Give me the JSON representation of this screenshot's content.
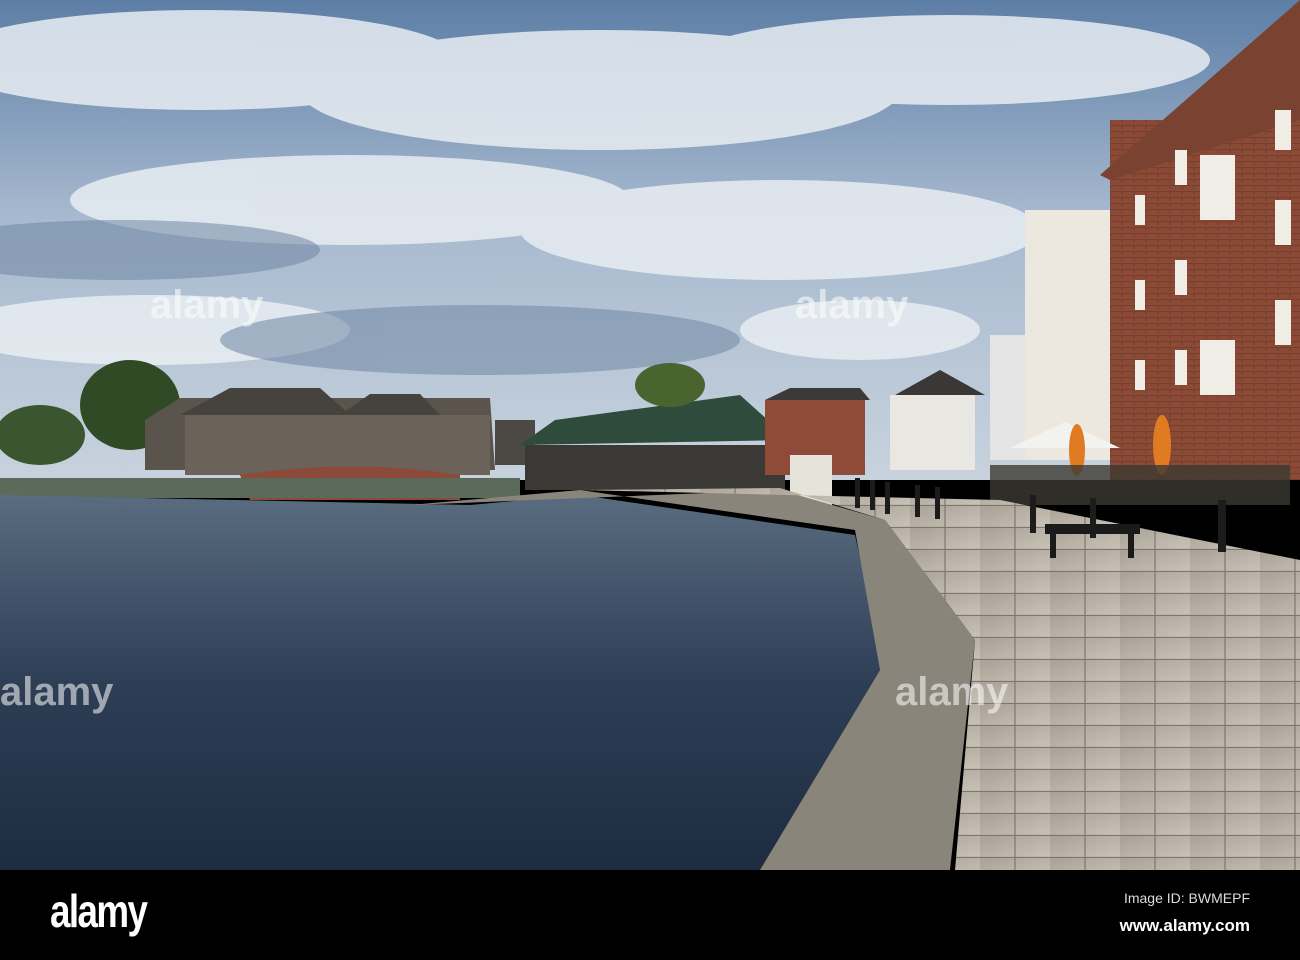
{
  "photo": {
    "subject": "Exeter Quay riverside with warehouses",
    "watermark": "alamy"
  },
  "footer": {
    "logo": "alamy",
    "image_id": "Image ID: BWMEPF",
    "url": "www.alamy.com"
  }
}
